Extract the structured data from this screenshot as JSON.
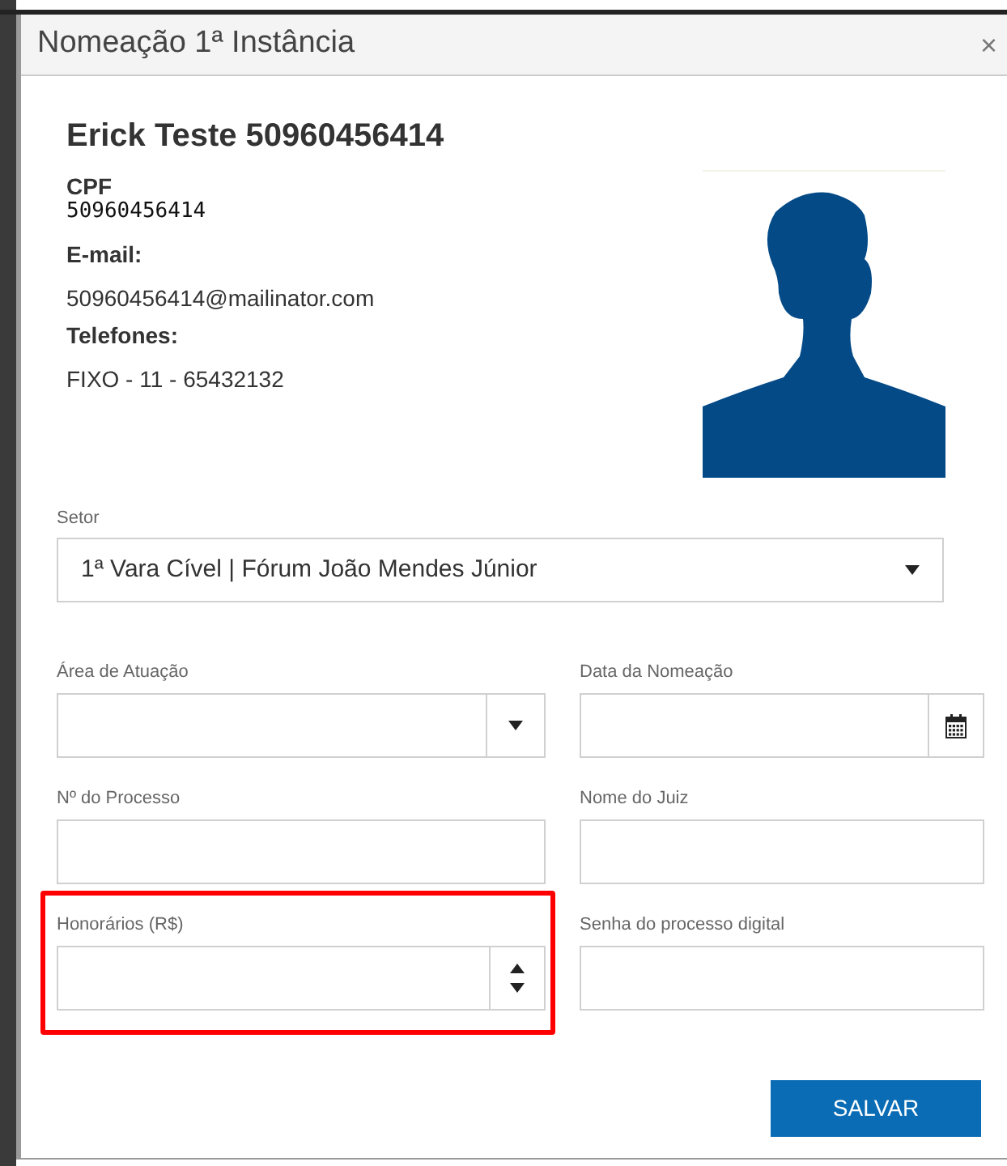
{
  "dialog": {
    "title": "Nomeação 1ª Instância",
    "close": "×"
  },
  "person": {
    "name": "Erick Teste 50960456414",
    "details": [
      {
        "label": "CPF",
        "value": "50960456414",
        "mono": true
      },
      {
        "label": "E-mail:",
        "value": "50960456414@mailinator.com",
        "mono": false
      },
      {
        "label": "Telefones:",
        "value": "FIXO - 11 - 65432132",
        "mono": false
      }
    ]
  },
  "setor": {
    "label": "Setor",
    "value": "1ª Vara Cível | Fórum João Mendes Júnior"
  },
  "fields": [
    {
      "label": "Área de Atuação",
      "kind": "select",
      "highlighted": false
    },
    {
      "label": "Data da Nomeação",
      "kind": "date",
      "highlighted": false
    },
    {
      "label": "Nº do Processo",
      "kind": "text",
      "highlighted": false
    },
    {
      "label": "Nome do Juiz",
      "kind": "text",
      "highlighted": false
    },
    {
      "label": "Honorários (R$)",
      "kind": "number",
      "highlighted": true
    },
    {
      "label": "Senha do processo digital",
      "kind": "text",
      "highlighted": false
    }
  ],
  "save_button": "SALVAR"
}
